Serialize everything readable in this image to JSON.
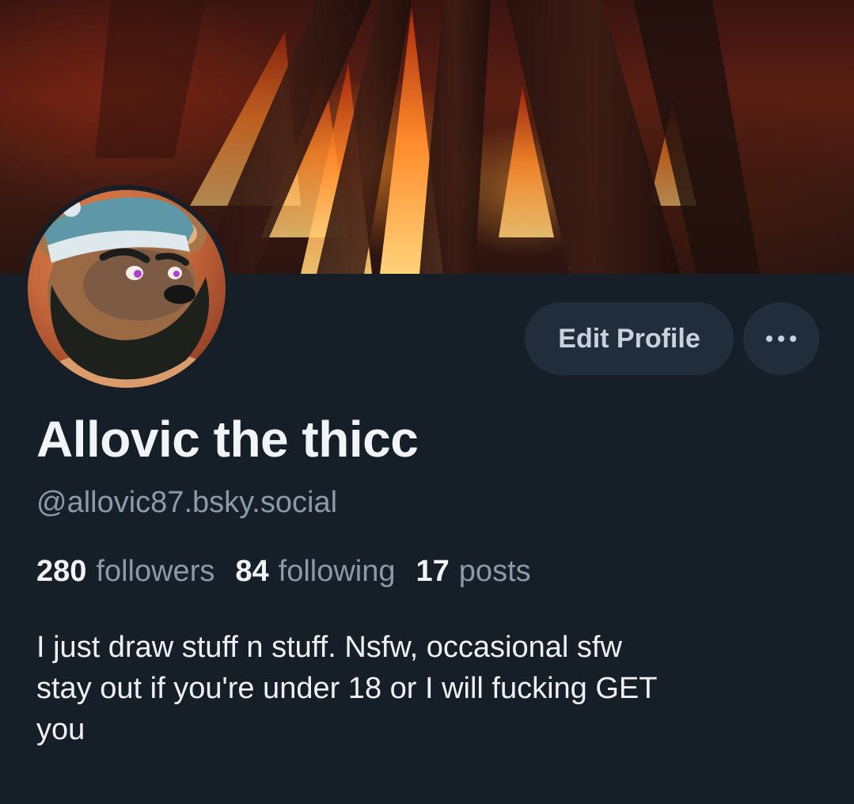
{
  "profile": {
    "display_name": "Allovic the thicc",
    "handle": "@allovic87.bsky.social",
    "banner_icon": "campfire-banner-image",
    "avatar_icon": "bear-avatar-image"
  },
  "actions": {
    "edit_label": "Edit Profile",
    "more_icon": "more-options-icon"
  },
  "stats": {
    "followers_count": "280",
    "followers_label": "followers",
    "following_count": "84",
    "following_label": "following",
    "posts_count": "17",
    "posts_label": "posts"
  },
  "bio": {
    "lines": [
      "I just draw stuff n stuff. Nsfw, occasional sfw",
      "stay out if you're under 18 or I will fucking GET",
      "you"
    ]
  },
  "colors": {
    "background": "#161e27",
    "button_bg": "#212d3b",
    "muted_text": "#8b99a8",
    "primary_text": "#f2f5f8"
  }
}
